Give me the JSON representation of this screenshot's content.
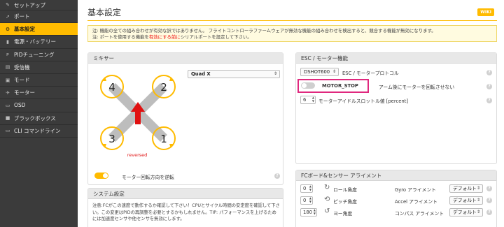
{
  "sidebar": {
    "items": [
      {
        "icon": "wrench-icon",
        "glyph": "✎",
        "label": "セットアップ"
      },
      {
        "icon": "plug-icon",
        "glyph": "➚",
        "label": "ポート"
      },
      {
        "icon": "gear-icon",
        "glyph": "⚙",
        "label": "基本設定"
      },
      {
        "icon": "battery-icon",
        "glyph": "▮",
        "label": "電源・バッテリー"
      },
      {
        "icon": "pid-icon",
        "glyph": "ᴘ",
        "label": "PIDチューニング"
      },
      {
        "icon": "receiver-icon",
        "glyph": "▤",
        "label": "受信機"
      },
      {
        "icon": "modes-icon",
        "glyph": "▣",
        "label": "モード"
      },
      {
        "icon": "motor-icon",
        "glyph": "✈",
        "label": "モーター"
      },
      {
        "icon": "osd-icon",
        "glyph": "▭",
        "label": "OSD"
      },
      {
        "icon": "blackbox-icon",
        "glyph": "■",
        "label": "ブラックボックス"
      },
      {
        "icon": "cli-icon",
        "glyph": "▭",
        "label": "CLI コマンドライン"
      }
    ],
    "active_index": 2,
    "accent": "#ffbb00"
  },
  "header": {
    "title": "基本設定",
    "wiki": "WIKI"
  },
  "notice": {
    "line1": "注: 機能の全ての組み合わせが有効な訳ではありません。 フライトコントローラファームウェアが無効な機能の組み合わせを検出すると、競合する機能が無効になります。",
    "line2_pre": "注: ポートを使用する機能を",
    "line2_red": "有効にする前に",
    "line2_post": "シリアルポートを設定して下さい。"
  },
  "mixer": {
    "title": "ミキサー",
    "type": "Quad X",
    "motors": [
      "4",
      "2",
      "3",
      "1"
    ],
    "reversed_label": "reversed",
    "reverse_toggle_label": "モーター回転方向を逆転",
    "reverse_on": true
  },
  "system": {
    "title": "システム設定",
    "text": "注意:FCがこの速度で動作するか確認して下さい！CPUとサイクル時間の安定度を確認して下さい。この変更はPIDの再調整を必要とするかもしれません。TIP: パフォーマンスを上げるためには加速度センサや他センサを無効にします。"
  },
  "esc": {
    "title": "ESC / モーター機能",
    "protocol": "DSHOT600",
    "protocol_label": "ESC / モータープロトコル",
    "motor_stop_label": "MOTOR_STOP",
    "motor_stop_desc": "アーム後にモーターを回転させない",
    "motor_stop_on": false,
    "idle_value": "6",
    "idle_label": "モーターアイドルスロットル値 [percent]"
  },
  "fc": {
    "title": "FCボード&センサー アライメント",
    "rows": [
      {
        "value": "0",
        "icon": "roll-icon",
        "label": "ロール角度",
        "align_label": "Gyro アライメント",
        "align_value": "デフォルト"
      },
      {
        "value": "0",
        "icon": "pitch-icon",
        "label": "ピッチ角度",
        "align_label": "Accel アライメント",
        "align_value": "デフォルト"
      },
      {
        "value": "180",
        "icon": "yaw-icon",
        "label": "ヨー角度",
        "align_label": "コンパス アライメント",
        "align_value": "デフォルト"
      }
    ]
  }
}
